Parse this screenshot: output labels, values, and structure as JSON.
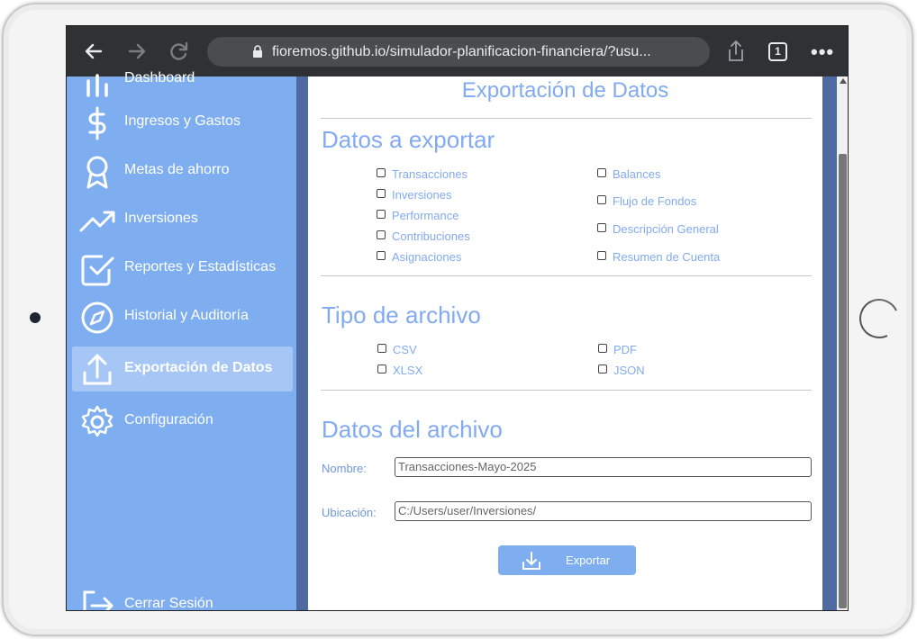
{
  "browser": {
    "url": "fioremos.github.io/simulador-planificacion-financiera/?usu...",
    "tab_count": "1"
  },
  "sidebar": {
    "items": [
      {
        "label": "Dashboard",
        "icon": "bar-chart-icon"
      },
      {
        "label": "Ingresos y Gastos",
        "icon": "dollar-icon"
      },
      {
        "label": "Metas de ahorro",
        "icon": "award-icon"
      },
      {
        "label": "Inversiones",
        "icon": "trending-up-icon"
      },
      {
        "label": "Reportes y Estadísticas",
        "icon": "check-square-icon"
      },
      {
        "label": "Historial y Auditoría",
        "icon": "compass-icon"
      },
      {
        "label": "Exportación de Datos",
        "icon": "upload-icon",
        "active": true
      },
      {
        "label": "Configuración",
        "icon": "gear-icon"
      }
    ],
    "logout_label": "Cerrar Sesión"
  },
  "main": {
    "title": "Exportación de Datos",
    "data_section": {
      "title": "Datos a exportar",
      "left_options": [
        "Transacciones",
        "Inversiones",
        "Performance",
        "Contribuciones",
        "Asignaciones"
      ],
      "right_options": [
        "Balances",
        "Flujo de Fondos",
        "Descripción General",
        "Resumen de Cuenta"
      ]
    },
    "file_type_section": {
      "title": "Tipo de archivo",
      "options": [
        "CSV",
        "PDF",
        "XLSX",
        "JSON"
      ]
    },
    "file_data_section": {
      "title": "Datos del archivo",
      "name_label": "Nombre:",
      "name_value": "Transacciones-Mayo-2025",
      "location_label": "Ubicación:",
      "location_value": "C:/Users/user/Inversiones/"
    },
    "export_label": "Exportar"
  },
  "colors": {
    "accent": "#82aaf0",
    "sidebar": "#7eaef0",
    "sidebar_border": "#4e6aa0",
    "browser_bar": "#303134"
  }
}
